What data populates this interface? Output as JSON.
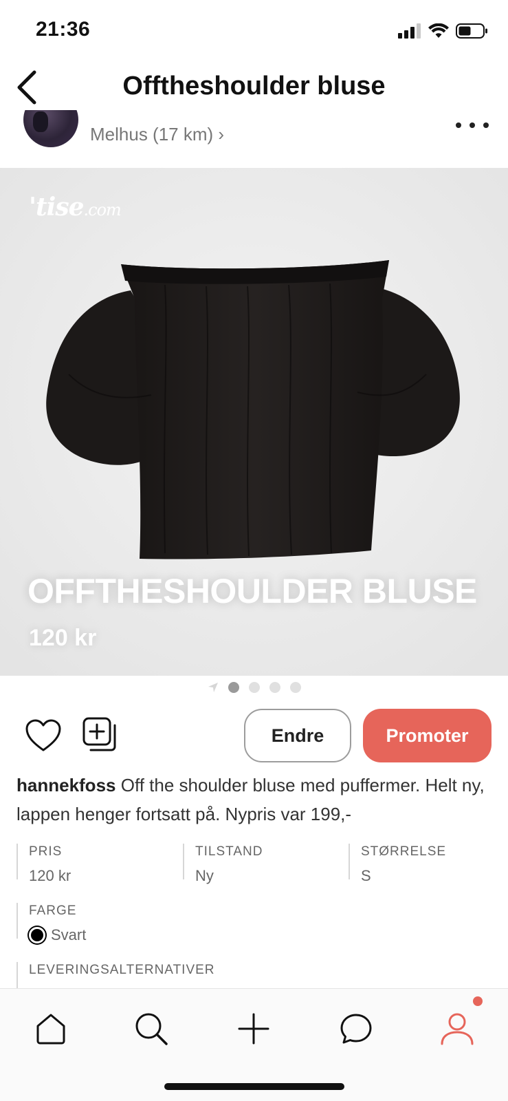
{
  "status_bar": {
    "time": "21:36"
  },
  "header": {
    "title": "Offtheshoulder bluse"
  },
  "seller": {
    "location": "Melhus (17 km)",
    "chevron": "›"
  },
  "product_image": {
    "watermark_main": "'tise",
    "watermark_suffix": ".com",
    "title": "OFFTHESHOULDER BLUSE",
    "price": "120 kr",
    "pager_count": 4,
    "pager_active": 0
  },
  "actions": {
    "edit_label": "Endre",
    "promote_label": "Promoter"
  },
  "description": {
    "username": "hannekfoss",
    "text": " Off the shoulder bluse med puffermer. Helt ny, lappen henger fortsatt på. Nypris var 199,-"
  },
  "attributes": {
    "pris": {
      "label": "PRIS",
      "value": "120 kr"
    },
    "tilstand": {
      "label": "TILSTAND",
      "value": "Ny"
    },
    "storrelse": {
      "label": "STØRRELSE",
      "value": "S"
    },
    "farge": {
      "label": "FARGE",
      "value": "Svart",
      "swatch": "#000000"
    },
    "levering": {
      "label": "LEVERINGSALTERNATIVER"
    }
  },
  "icons": {
    "back": "chevron-left-icon",
    "more": "ellipsis-icon",
    "like": "heart-icon",
    "save": "collection-add-icon",
    "home": "home-icon",
    "search": "search-icon",
    "add": "plus-icon",
    "chat": "chat-bubble-icon",
    "profile": "user-icon"
  },
  "colors": {
    "accent": "#e6655a",
    "profile_tab": "#e6655a",
    "image_background": "#eeeeee",
    "garment": "#1e1b1a"
  }
}
